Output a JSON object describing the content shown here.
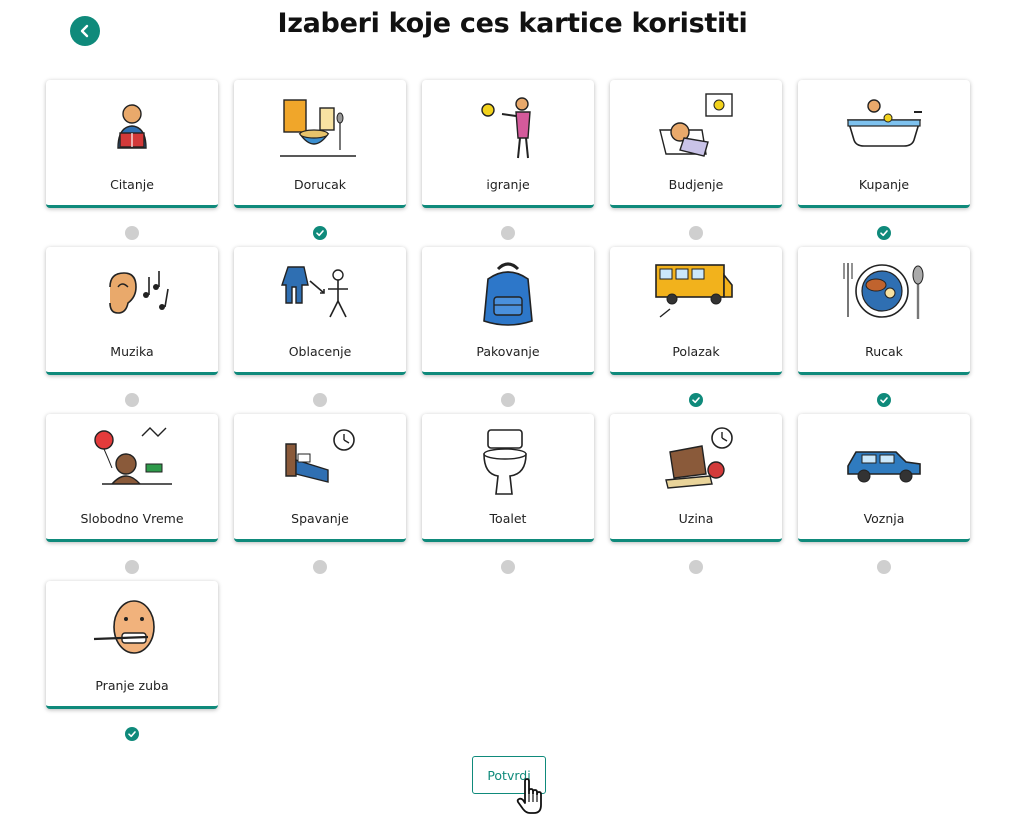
{
  "header": {
    "title": "Izaberi koje ces kartice koristiti",
    "back_icon": "chevron-left-icon"
  },
  "colors": {
    "accent": "#0f8a7b",
    "unchecked": "#cfcfcf"
  },
  "cards": [
    {
      "label": "Citanje",
      "icon": "reading-icon",
      "selected": false
    },
    {
      "label": "Dorucak",
      "icon": "breakfast-icon",
      "selected": true
    },
    {
      "label": "igranje",
      "icon": "playing-ball-icon",
      "selected": false
    },
    {
      "label": "Budjenje",
      "icon": "waking-up-icon",
      "selected": false
    },
    {
      "label": "Kupanje",
      "icon": "bathtub-icon",
      "selected": true
    },
    {
      "label": "Muzika",
      "icon": "music-ear-icon",
      "selected": false
    },
    {
      "label": "Oblacenje",
      "icon": "getting-dressed-icon",
      "selected": false
    },
    {
      "label": "Pakovanje",
      "icon": "backpack-icon",
      "selected": false
    },
    {
      "label": "Polazak",
      "icon": "school-bus-icon",
      "selected": true
    },
    {
      "label": "Rucak",
      "icon": "lunch-plate-icon",
      "selected": true
    },
    {
      "label": "Slobodno Vreme",
      "icon": "free-time-icon",
      "selected": false
    },
    {
      "label": "Spavanje",
      "icon": "bed-clock-icon",
      "selected": false
    },
    {
      "label": "Toalet",
      "icon": "toilet-icon",
      "selected": false
    },
    {
      "label": "Uzina",
      "icon": "snack-clock-icon",
      "selected": false
    },
    {
      "label": "Voznja",
      "icon": "car-icon",
      "selected": false
    },
    {
      "label": "Pranje zuba",
      "icon": "brushing-teeth-icon",
      "selected": true
    }
  ],
  "footer": {
    "confirm_label": "Potvrdi",
    "cursor_icon": "hand-pointer-icon"
  }
}
